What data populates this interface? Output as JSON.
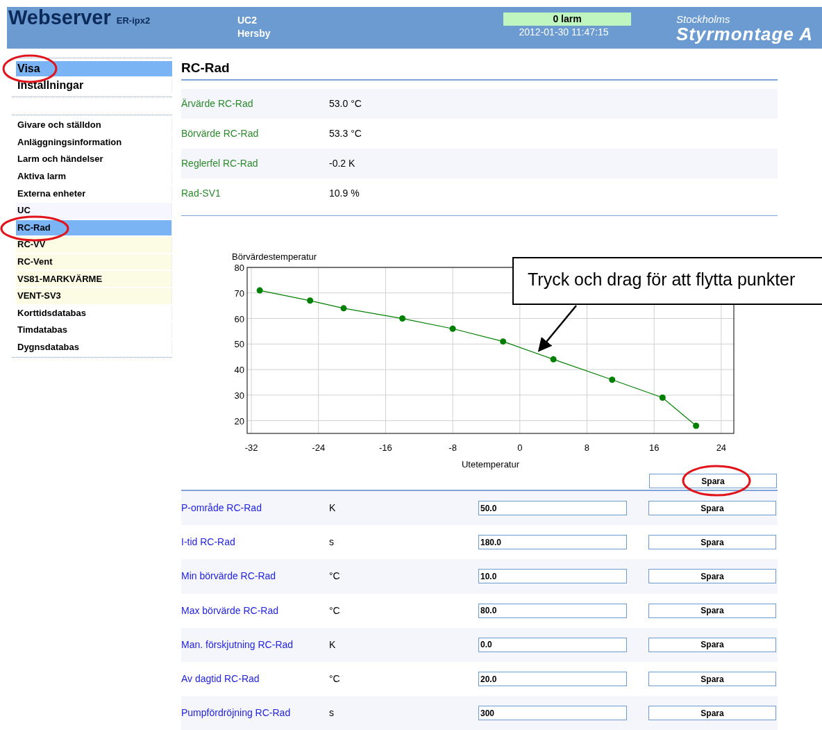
{
  "header": {
    "title": "Webserver",
    "model": "ER-ipx2",
    "unit": "UC2",
    "site": "Hersby",
    "alarm": "0 larm",
    "timestamp": "2012-01-30 11:47:15",
    "company_line1": "Stockholms",
    "company_line2": "Styrmontage A"
  },
  "sidebar": {
    "modes": [
      {
        "label": "Visa",
        "selected": true
      },
      {
        "label": "Inställningar",
        "selected": false
      }
    ],
    "items": [
      {
        "label": "Givare och ställdon",
        "selected": false,
        "color": "#ffffff"
      },
      {
        "label": "Anläggningsinformation",
        "selected": false,
        "color": "#ffffff"
      },
      {
        "label": "Larm och händelser",
        "selected": false,
        "color": "#ffffff"
      },
      {
        "label": "Aktiva larm",
        "selected": false,
        "color": "#ffffff"
      },
      {
        "label": "Externa enheter",
        "selected": false,
        "color": "#ffffff"
      },
      {
        "label": "UC",
        "selected": false,
        "color": "#f5f6ff"
      },
      {
        "label": "RC-Rad",
        "selected": true
      },
      {
        "label": "RC-VV",
        "selected": false,
        "color": "#fbfce3"
      },
      {
        "label": "RC-Vent",
        "selected": false,
        "color": "#fbfce3"
      },
      {
        "label": "VS81-MARKVÄRME",
        "selected": false,
        "color": "#fbfce3"
      },
      {
        "label": "VENT-SV3",
        "selected": false,
        "color": "#fbfce3"
      },
      {
        "label": "Korttidsdatabas",
        "selected": false,
        "color": "#ffffff"
      },
      {
        "label": "Timdatabas",
        "selected": false,
        "color": "#ffffff"
      },
      {
        "label": "Dygnsdatabas",
        "selected": false,
        "color": "#ffffff"
      }
    ]
  },
  "page_title": "RC-Rad",
  "readings": [
    {
      "label": "Ärvärde RC-Rad",
      "value": "53.0 °C"
    },
    {
      "label": "Börvärde RC-Rad",
      "value": "53.3 °C"
    },
    {
      "label": "Reglerfel RC-Rad",
      "value": "-0.2 K"
    },
    {
      "label": "Rad-SV1",
      "value": "10.9 %"
    }
  ],
  "chart": {
    "chart_data": {
      "type": "line",
      "ylabel": "Börvärdestemperatur",
      "xlabel": "Utetemperatur",
      "x": [
        -31,
        -25,
        -21,
        -14,
        -8,
        -2,
        4,
        11,
        17,
        21
      ],
      "grid": true,
      "series": [
        {
          "color": "#008000",
          "marker": true,
          "values": [
            71,
            67,
            64,
            60,
            56,
            51,
            44,
            36,
            29,
            18
          ]
        }
      ],
      "xlim": [
        -32.5,
        25.5
      ],
      "ylim": [
        15,
        80
      ],
      "xticks": [
        -32,
        -24,
        -16,
        -8,
        0,
        8,
        16,
        24
      ],
      "yticks": [
        20,
        30,
        40,
        50,
        60,
        70,
        80
      ]
    },
    "callout": "Tryck och drag för att flytta punkter",
    "save_button": "Spara"
  },
  "settings": [
    {
      "label": "P-område RC-Rad",
      "unit": "K",
      "value": "50.0",
      "button": "Spara"
    },
    {
      "label": "I-tid RC-Rad",
      "unit": "s",
      "value": "180.0",
      "button": "Spara"
    },
    {
      "label": "Min börvärde RC-Rad",
      "unit": "°C",
      "value": "10.0",
      "button": "Spara"
    },
    {
      "label": "Max börvärde RC-Rad",
      "unit": "°C",
      "value": "80.0",
      "button": "Spara"
    },
    {
      "label": "Man. förskjutning RC-Rad",
      "unit": "K",
      "value": "0.0",
      "button": "Spara"
    },
    {
      "label": "Av dagtid RC-Rad",
      "unit": "°C",
      "value": "20.0",
      "button": "Spara"
    },
    {
      "label": "Pumpfördröjning RC-Rad",
      "unit": "s",
      "value": "300",
      "button": "Spara"
    }
  ]
}
